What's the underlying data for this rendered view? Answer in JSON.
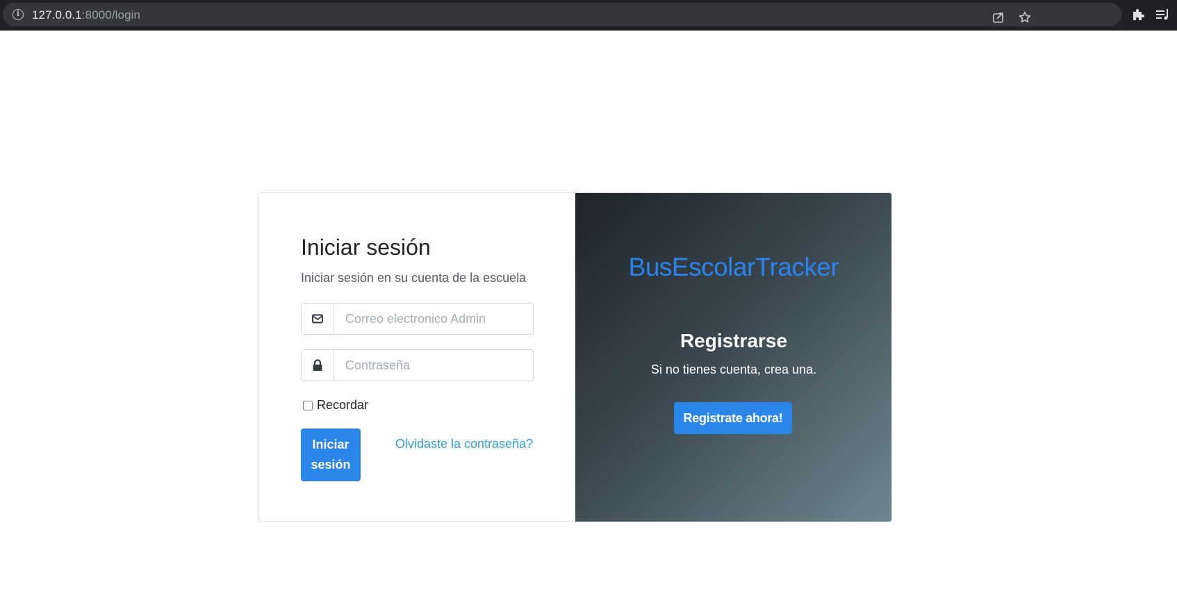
{
  "browser": {
    "url_host": "127.0.0.1",
    "url_rest": ":8000/login",
    "icons": [
      "info-icon",
      "share-icon",
      "star-icon",
      "extensions-icon",
      "media-queue-icon"
    ]
  },
  "login": {
    "title": "Iniciar sesión",
    "subtitle": "Iniciar sesión en su cuenta de la escuela",
    "email_placeholder": "Correo electronico Admin",
    "password_placeholder": "Contraseña",
    "remember_label": "Recordar",
    "submit_label": "Iniciar sesión",
    "forgot_label": "Olvidaste la contraseña?"
  },
  "register": {
    "brand": "BusEscolarTracker",
    "title": "Registrarse",
    "text": "Si no tienes cuenta, crea una.",
    "button_label": "Registrate ahora!"
  },
  "colors": {
    "primary": "#2b86ea",
    "brand": "#2a84f0",
    "link": "#2d9fd6",
    "gradient_start": "#1f2529",
    "gradient_end": "#6e8790"
  }
}
